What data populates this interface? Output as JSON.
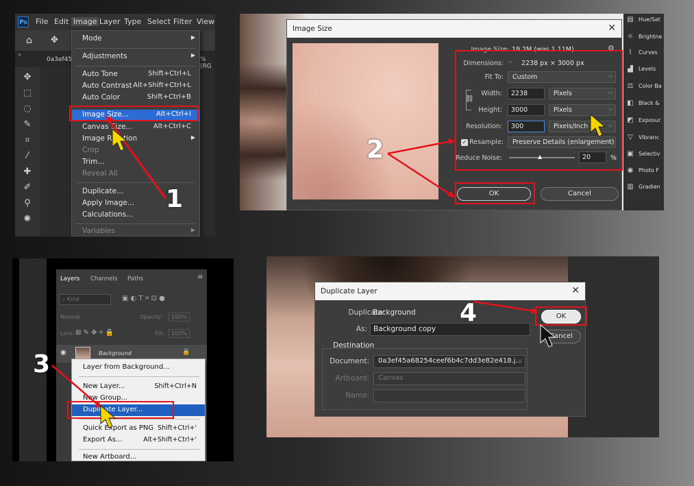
{
  "steps": [
    "1",
    "2",
    "3",
    "4"
  ],
  "colors": {
    "highlight_box": "#e0141a",
    "menu_highlight": "#2d6bd6"
  },
  "panel1": {
    "app_icon": "Ps",
    "menubar": [
      "File",
      "Edit",
      "Image",
      "Layer",
      "Type",
      "Select",
      "Filter",
      "View"
    ],
    "doc_tab": "0a3ef45",
    "doc_tab_suffix": "% (RG",
    "menu": [
      {
        "label": "Mode",
        "shortcut": "",
        "submenu": true,
        "disabled": false
      },
      {
        "label": "Adjustments",
        "shortcut": "",
        "submenu": true,
        "disabled": false
      },
      {
        "label": "Auto Tone",
        "shortcut": "Shift+Ctrl+L",
        "submenu": false,
        "disabled": false
      },
      {
        "label": "Auto Contrast",
        "shortcut": "Alt+Shift+Ctrl+L",
        "submenu": false,
        "disabled": false
      },
      {
        "label": "Auto Color",
        "shortcut": "Shift+Ctrl+B",
        "submenu": false,
        "disabled": false
      },
      {
        "label": "Image Size...",
        "shortcut": "Alt+Ctrl+I",
        "submenu": false,
        "disabled": false,
        "highlighted": true
      },
      {
        "label": "Canvas Size...",
        "shortcut": "Alt+Ctrl+C",
        "submenu": false,
        "disabled": false
      },
      {
        "label": "Image Rotation",
        "shortcut": "",
        "submenu": true,
        "disabled": false
      },
      {
        "label": "Crop",
        "shortcut": "",
        "submenu": false,
        "disabled": true
      },
      {
        "label": "Trim...",
        "shortcut": "",
        "submenu": false,
        "disabled": false
      },
      {
        "label": "Reveal All",
        "shortcut": "",
        "submenu": false,
        "disabled": true
      },
      {
        "label": "Duplicate...",
        "shortcut": "",
        "submenu": false,
        "disabled": false
      },
      {
        "label": "Apply Image...",
        "shortcut": "",
        "submenu": false,
        "disabled": false
      },
      {
        "label": "Calculations...",
        "shortcut": "",
        "submenu": false,
        "disabled": false
      },
      {
        "label": "Variables",
        "shortcut": "",
        "submenu": true,
        "disabled": true
      }
    ]
  },
  "panel2": {
    "title": "Image Size",
    "image_size_label": "Image Size:",
    "image_size_value": "19.2M (was 1.11M)",
    "dimensions_label": "Dimensions:",
    "dimensions_value": "2238 px  ×  3000 px",
    "fit_to_label": "Fit To:",
    "fit_to_value": "Custom",
    "width_label": "Width:",
    "width_value": "2238",
    "width_unit": "Pixels",
    "height_label": "Height:",
    "height_value": "3000",
    "height_unit": "Pixels",
    "resolution_label": "Resolution:",
    "resolution_value": "300",
    "resolution_unit": "Pixels/Inch",
    "resample_label": "Resample:",
    "resample_value": "Preserve Details (enlargement)",
    "reduce_noise_label": "Reduce Noise:",
    "reduce_noise_value": "20",
    "reduce_noise_unit": "%",
    "ok": "OK",
    "cancel": "Cancel",
    "adjustments": [
      "Hue/Sat",
      "Brightne",
      "Curves",
      "Levels",
      "Color Ba",
      "Black &",
      "Exposur",
      "Vibranc",
      "Selectiv",
      "Photo F",
      "Gradien"
    ]
  },
  "panel3": {
    "tabs": [
      "Layers",
      "Channels",
      "Paths"
    ],
    "kind": "Kind",
    "blend": "Normal",
    "opacity_label": "Opacity:",
    "opacity_value": "100%",
    "lock_label": "Lock:",
    "fill_label": "Fill:",
    "fill_value": "100%",
    "layer_name": "Background",
    "menu": [
      {
        "label": "Layer from Background...",
        "shortcut": ""
      },
      {
        "label": "New Layer...",
        "shortcut": "Shift+Ctrl+N"
      },
      {
        "label": "New Group...",
        "shortcut": ""
      },
      {
        "label": "Duplicate Layer...",
        "shortcut": "",
        "highlighted": true
      },
      {
        "label": "Quick Export as PNG",
        "shortcut": "Shift+Ctrl+'"
      },
      {
        "label": "Export As...",
        "shortcut": "Alt+Shift+Ctrl+'"
      },
      {
        "label": "New Artboard...",
        "shortcut": ""
      }
    ]
  },
  "panel4": {
    "title": "Duplicate Layer",
    "duplicate_label": "Duplicate:",
    "duplicate_value": "Background",
    "as_label": "As:",
    "as_value": "Background copy",
    "destination_label": "Destination",
    "document_label": "Document:",
    "document_value": "0a3ef45a68254ceef6b4c7dd3e82e418.j...",
    "artboard_label": "Artboard:",
    "artboard_value": "Canvas",
    "name_label": "Name:",
    "name_value": "",
    "ok": "OK",
    "cancel": "Cancel"
  }
}
